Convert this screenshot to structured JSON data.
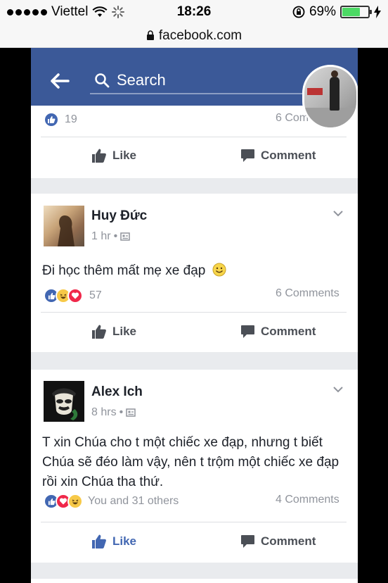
{
  "status_bar": {
    "carrier": "Viettel",
    "time": "18:26",
    "battery_percent": "69%",
    "battery_level": 0.69
  },
  "url_bar": {
    "url": "facebook.com"
  },
  "fb_header": {
    "search_placeholder": "Search"
  },
  "top_post": {
    "reaction_count": "19",
    "comments": "6 Com",
    "like_label": "Like",
    "comment_label": "Comment"
  },
  "posts": [
    {
      "author": "Huy Đức",
      "time": "1 hr",
      "dot": "•",
      "text": "Đi học thêm mất mẹ xe đạp",
      "reaction_count": "57",
      "comments": "6 Comments",
      "like_label": "Like",
      "comment_label": "Comment"
    },
    {
      "author": "Alex Ich",
      "time": "8 hrs",
      "dot": "•",
      "text": "T xin Chúa cho t một chiếc xe đạp, nhưng t biết Chúa sẽ đéo làm vậy, nên t trộm một chiếc xe đạp rồi xin Chúa tha thứ.",
      "reaction_count": "You and 31 others",
      "comments": "4 Comments",
      "like_label": "Like",
      "comment_label": "Comment"
    }
  ],
  "colors": {
    "facebook_blue": "#3b5998",
    "like_blue": "#4267b2",
    "feed_bg": "#e9ebee",
    "battery_green": "#4cd964"
  }
}
